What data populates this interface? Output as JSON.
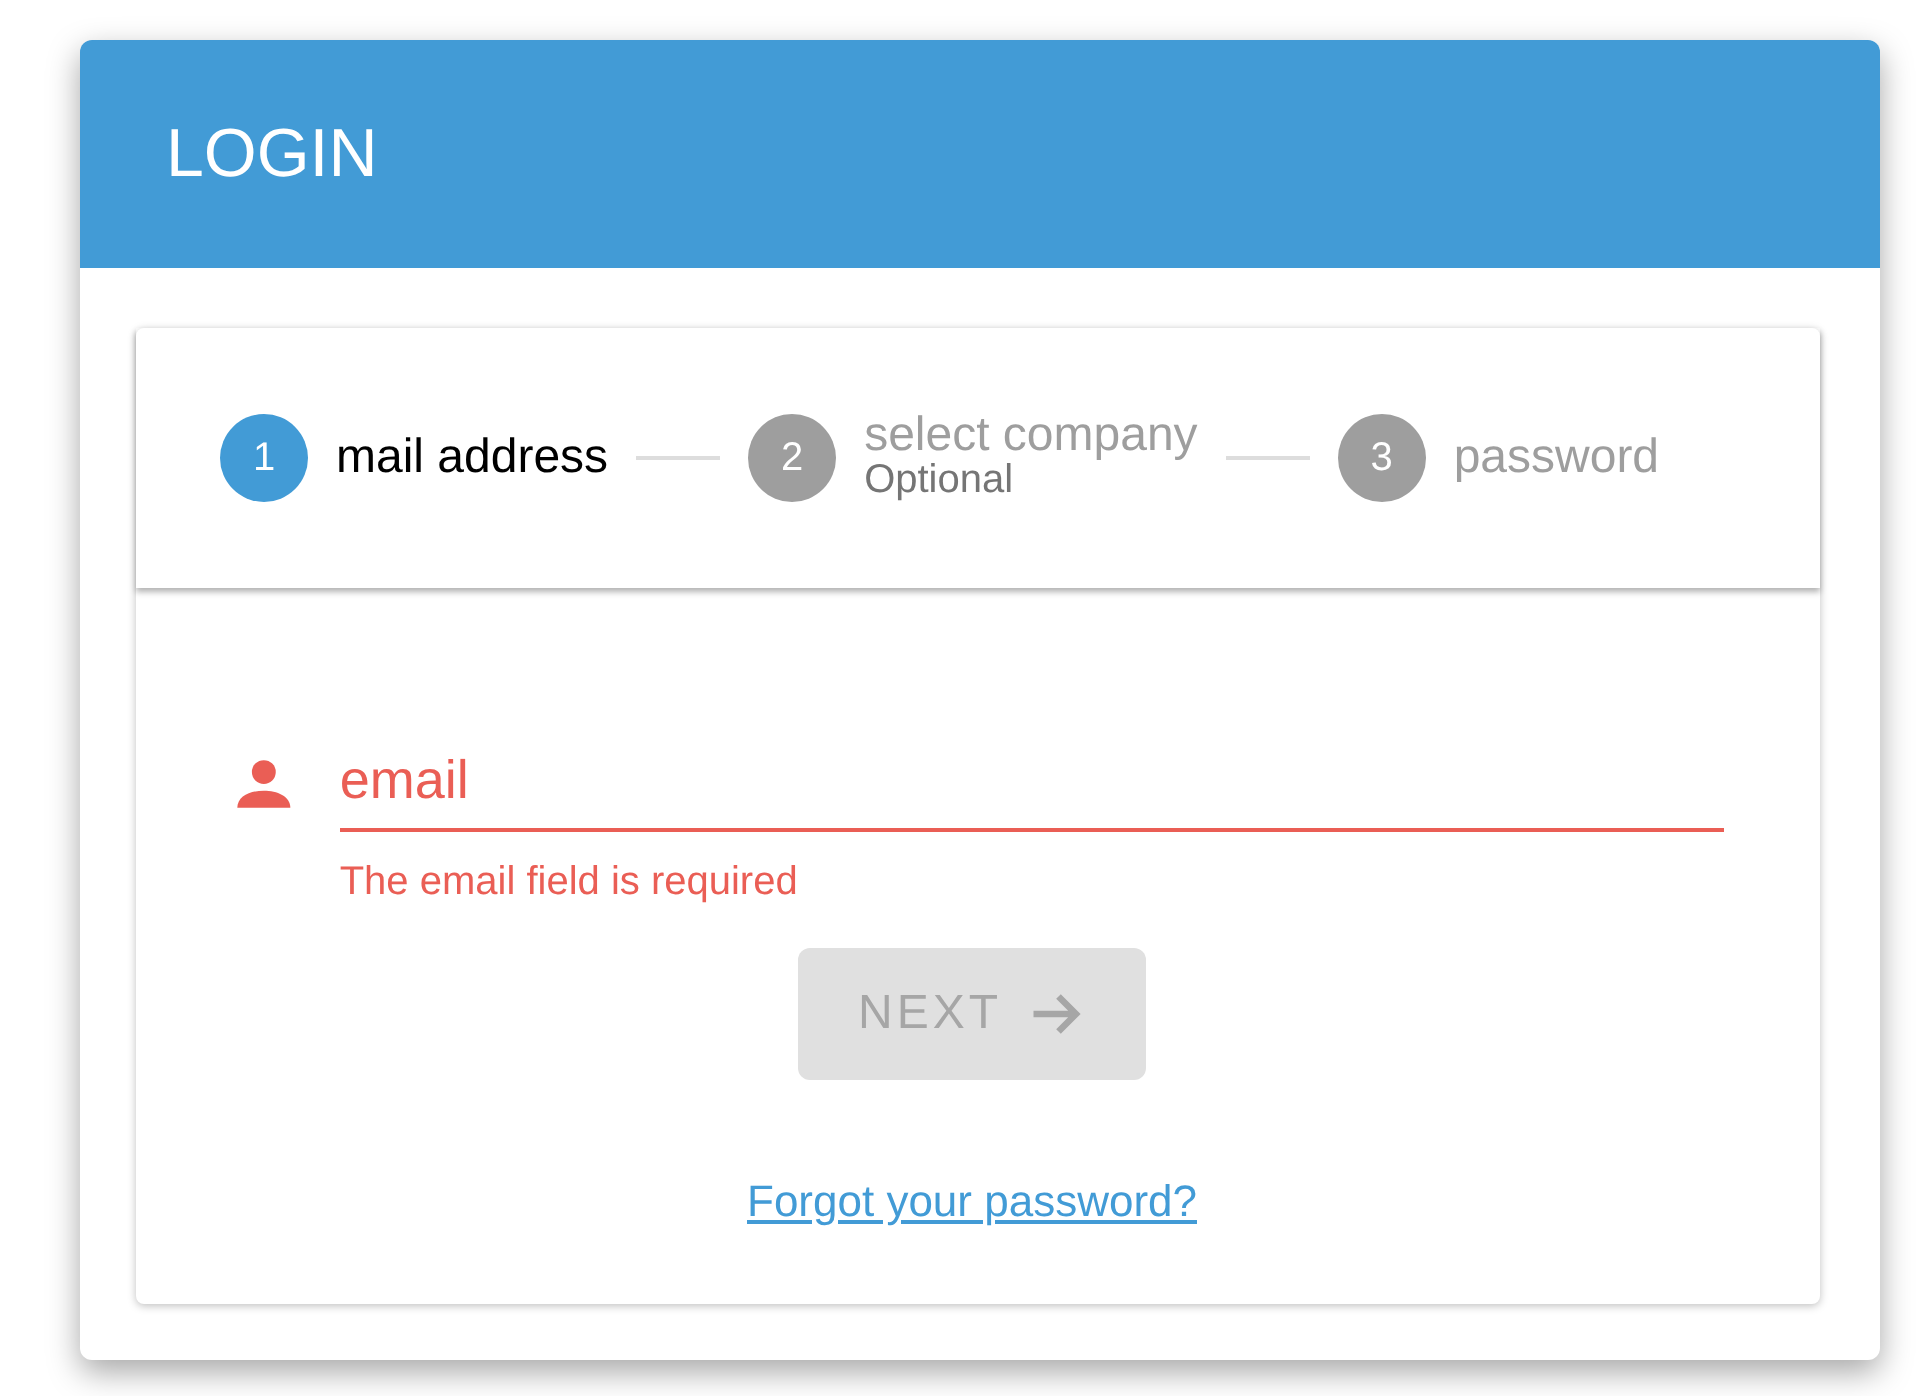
{
  "header": {
    "title": "LOGIN"
  },
  "steps": [
    {
      "number": "1",
      "label": "mail address",
      "active": true
    },
    {
      "number": "2",
      "label": "select company",
      "note": "Optional",
      "active": false
    },
    {
      "number": "3",
      "label": "password",
      "active": false
    }
  ],
  "email_field": {
    "placeholder": "email",
    "invalid": true,
    "error": "The email field is required"
  },
  "next_button": {
    "label": "NEXT",
    "disabled": true
  },
  "forgot_link": "Forgot your password?"
}
